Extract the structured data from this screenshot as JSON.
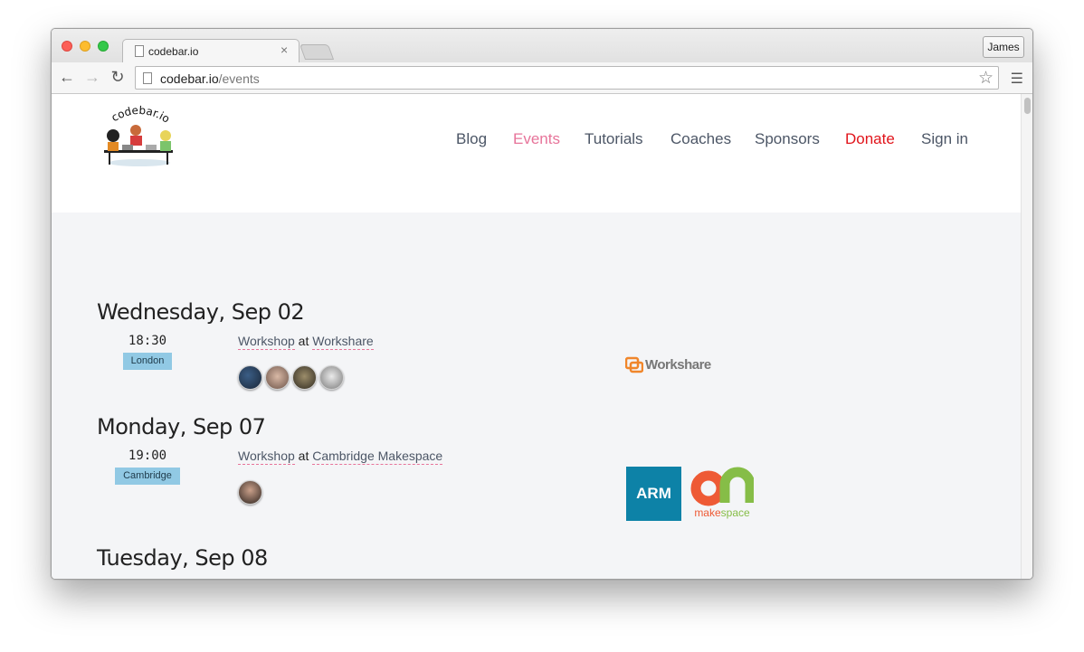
{
  "browser": {
    "tab_title": "codebar.io",
    "tab_close": "×",
    "profile_name": "James",
    "url_domain": "codebar.io",
    "url_path": "/events",
    "back_icon": "back-arrow-icon",
    "forward_icon": "forward-arrow-icon",
    "reload_icon": "reload-icon",
    "star_icon": "bookmark-star-icon",
    "menu_icon": "hamburger-menu-icon"
  },
  "site": {
    "logo_text": "codebar.io",
    "nav": [
      {
        "label": "Blog",
        "active": false
      },
      {
        "label": "Events",
        "active": true
      },
      {
        "label": "Tutorials",
        "active": false
      },
      {
        "label": "Coaches",
        "active": false
      },
      {
        "label": "Sponsors",
        "active": false
      },
      {
        "label": "Donate",
        "active": false
      },
      {
        "label": "Sign in",
        "active": false
      }
    ],
    "colors": {
      "accent": "#e7749a",
      "donate": "#e1141b",
      "nav_text": "#4c5666",
      "city_badge": "#91c9e4"
    }
  },
  "events": [
    {
      "date": "Wednesday, Sep 02",
      "time": "18:30",
      "city": "London",
      "type": "Workshop",
      "at": "at",
      "venue": "Workshare",
      "sponsors": [
        "Workshare"
      ]
    },
    {
      "date": "Monday, Sep 07",
      "time": "19:00",
      "city": "Cambridge",
      "type": "Workshop",
      "at": "at",
      "venue": "Cambridge Makespace",
      "sponsors": [
        "ARM",
        "makespace"
      ]
    },
    {
      "date": "Tuesday, Sep 08"
    }
  ],
  "sponsor_logos": {
    "workshare": "Workshare",
    "arm": "ARM",
    "makespace_a": "make",
    "makespace_b": "space"
  }
}
